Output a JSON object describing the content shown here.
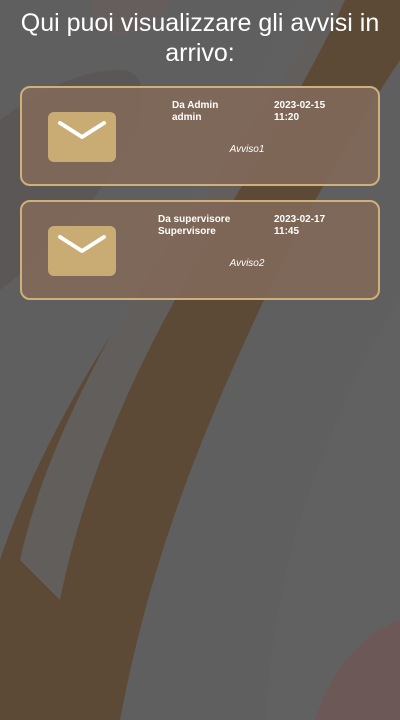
{
  "page": {
    "title": "Qui puoi visualizzare gli avvisi in arrivo:"
  },
  "colors": {
    "background": "#5f5f5f",
    "band_brown": "#5c4a36",
    "card_fill": "#806858",
    "card_border": "#cdb07a",
    "envelope": "#c9ab74"
  },
  "notices": [
    {
      "sender_label": "Da Admin",
      "sender_name": "admin",
      "date": "2023-02-15",
      "time": "11:20",
      "subject": "Avviso1",
      "icon": "envelope-icon"
    },
    {
      "sender_label": "Da supervisore",
      "sender_name": "Supervisore",
      "date": "2023-02-17",
      "time": "11:45",
      "subject": "Avviso2",
      "icon": "envelope-icon"
    }
  ]
}
